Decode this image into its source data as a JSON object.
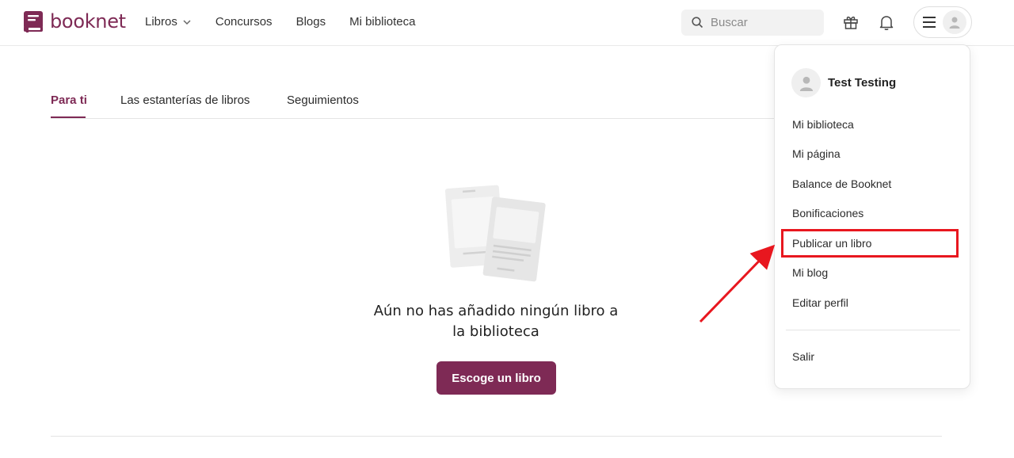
{
  "brand": {
    "name": "booknet",
    "color": "#7e2a55"
  },
  "nav": {
    "items": [
      {
        "label": "Libros"
      },
      {
        "label": "Concursos"
      },
      {
        "label": "Blogs"
      },
      {
        "label": "Mi biblioteca"
      }
    ]
  },
  "search": {
    "placeholder": "Buscar"
  },
  "header_icons": [
    "gift-icon",
    "bell-icon",
    "hamburger-icon",
    "avatar-icon"
  ],
  "tabs": [
    {
      "label": "Para ti",
      "active": true
    },
    {
      "label": "Las estanterías de libros",
      "active": false
    },
    {
      "label": "Seguimientos",
      "active": false
    }
  ],
  "empty_state": {
    "title": "Aún no has añadido ningún libro a la biblioteca",
    "button_label": "Escoge un libro"
  },
  "dropdown": {
    "user_name": "Test Testing",
    "items": [
      {
        "label": "Mi biblioteca"
      },
      {
        "label": "Mi página"
      },
      {
        "label": "Balance de Booknet"
      },
      {
        "label": "Bonificaciones"
      },
      {
        "label": "Publicar un libro",
        "highlighted": true
      },
      {
        "label": "Mi blog"
      },
      {
        "label": "Editar perfil"
      }
    ],
    "logout_label": "Salir"
  },
  "annotation": {
    "highlight_color": "#e8171f"
  }
}
